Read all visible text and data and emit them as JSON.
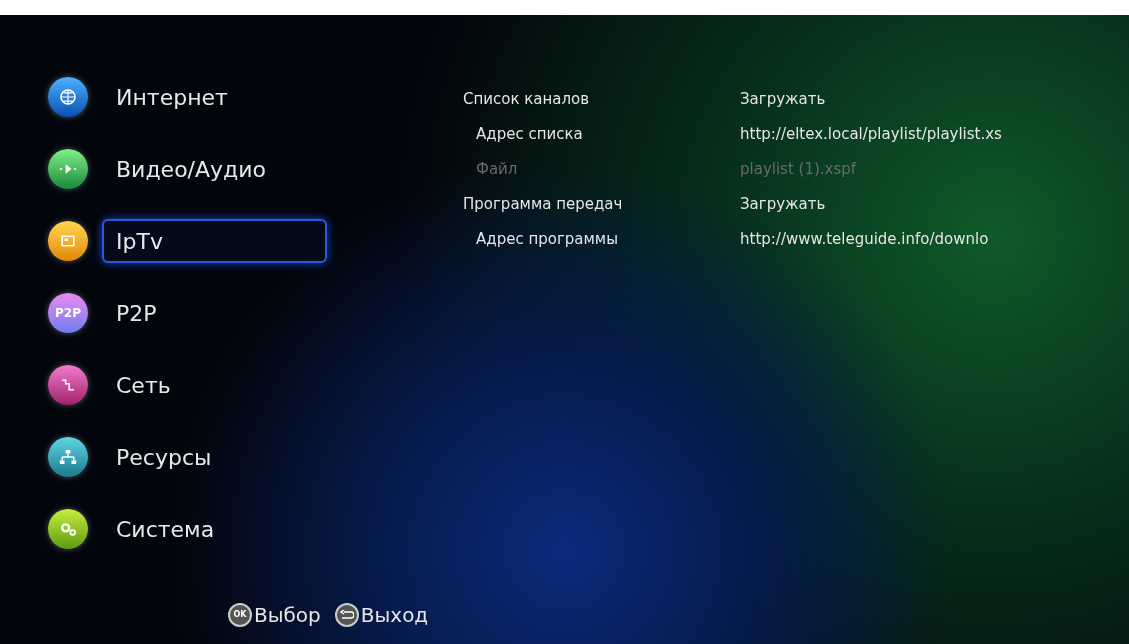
{
  "menu": [
    {
      "label": "Интернет",
      "kind": "globe",
      "selected": false
    },
    {
      "label": "Видео/Аудио",
      "kind": "play",
      "selected": false
    },
    {
      "label": "IpTv",
      "kind": "tv",
      "selected": true
    },
    {
      "label": "P2P",
      "kind": "p2p",
      "icon_text": "P2P",
      "selected": false
    },
    {
      "label": "Сеть",
      "kind": "network",
      "selected": false
    },
    {
      "label": "Ресурсы",
      "kind": "resources",
      "selected": false
    },
    {
      "label": "Система",
      "kind": "gears",
      "selected": false
    }
  ],
  "settings": [
    {
      "label": "Список каналов",
      "value": "Загружать",
      "disabled": false,
      "children": [
        {
          "label": "Адрес списка",
          "value": "http://eltex.local/playlist/playlist.xs",
          "disabled": false
        },
        {
          "label": "Файл",
          "value": "playlist (1).xspf",
          "disabled": true
        }
      ]
    },
    {
      "label": "Программа передач",
      "value": "Загружать",
      "disabled": false,
      "children": [
        {
          "label": "Адрес программы",
          "value": "http://www.teleguide.info/downlo",
          "disabled": false
        }
      ]
    }
  ],
  "hints": [
    {
      "kind": "ok",
      "key_text": "OK",
      "label": "Выбор"
    },
    {
      "kind": "back",
      "label": "Выход"
    }
  ]
}
